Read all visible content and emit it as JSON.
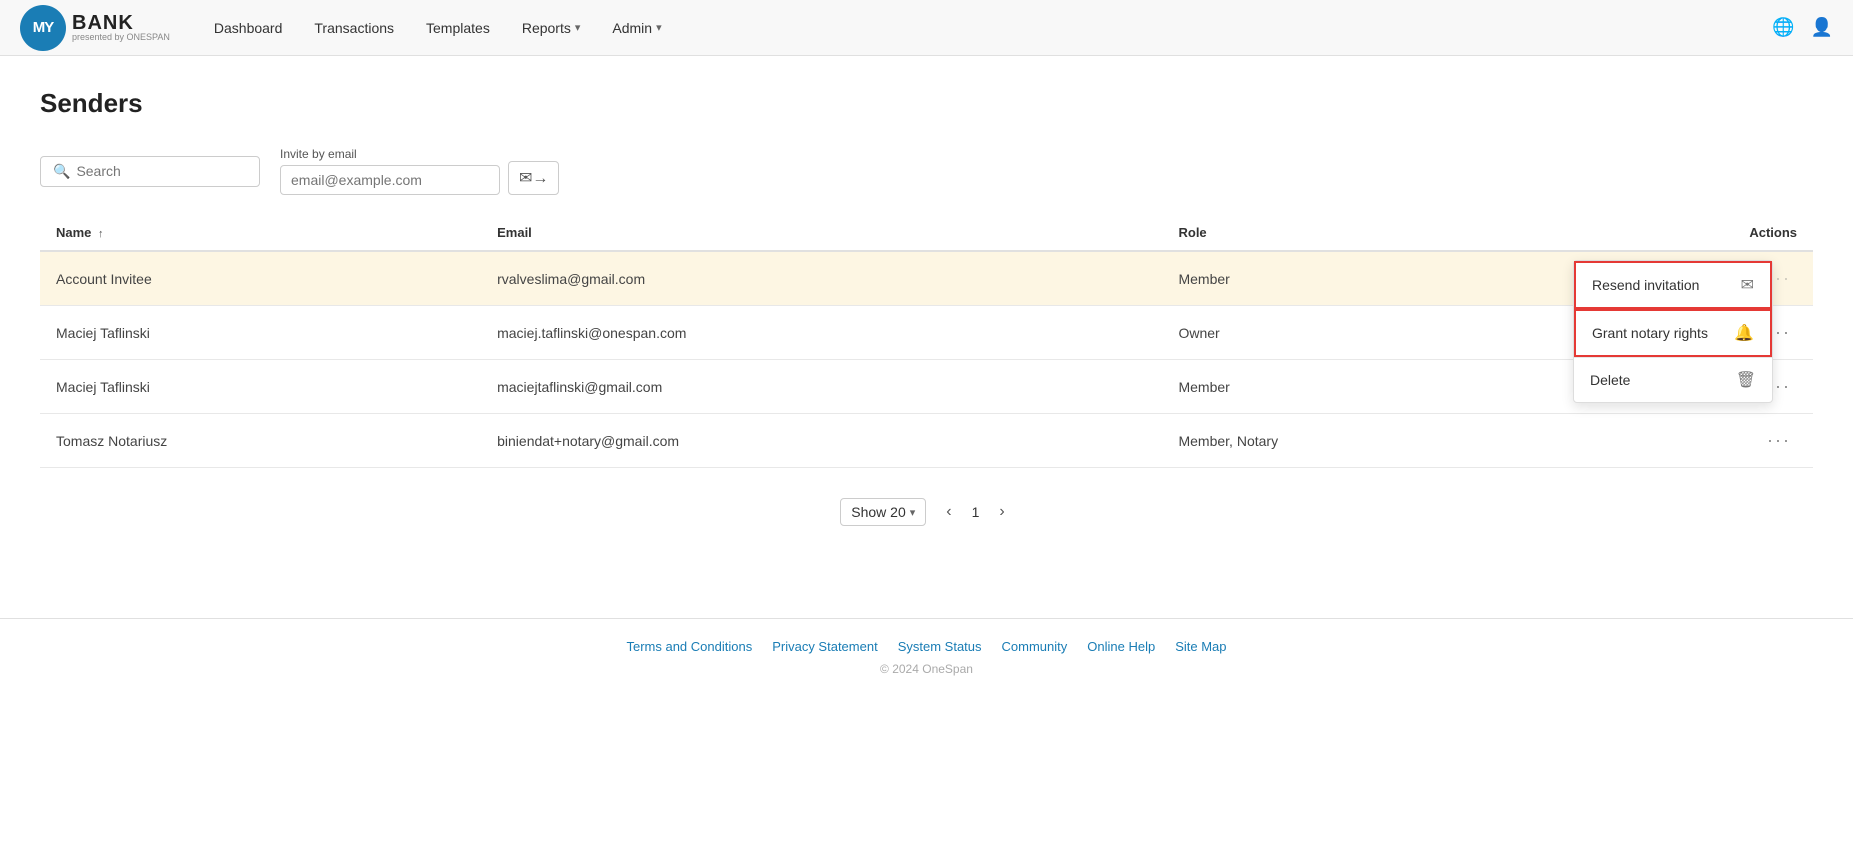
{
  "brand": {
    "logo_text": "MY BANK",
    "logo_my": "MY",
    "logo_bank": "BANK",
    "logo_sub": "presented by ONESPAN"
  },
  "nav": {
    "links": [
      {
        "id": "dashboard",
        "label": "Dashboard",
        "has_dropdown": false
      },
      {
        "id": "transactions",
        "label": "Transactions",
        "has_dropdown": false
      },
      {
        "id": "templates",
        "label": "Templates",
        "has_dropdown": false
      },
      {
        "id": "reports",
        "label": "Reports",
        "has_dropdown": true
      },
      {
        "id": "admin",
        "label": "Admin",
        "has_dropdown": true
      }
    ]
  },
  "page": {
    "title": "Senders"
  },
  "toolbar": {
    "search_placeholder": "Search",
    "invite_label": "Invite by email",
    "invite_placeholder": "email@example.com",
    "invite_btn_icon": "✉"
  },
  "table": {
    "columns": [
      {
        "id": "name",
        "label": "Name",
        "sortable": true
      },
      {
        "id": "email",
        "label": "Email",
        "sortable": false
      },
      {
        "id": "role",
        "label": "Role",
        "sortable": false
      },
      {
        "id": "actions",
        "label": "Actions",
        "sortable": false
      }
    ],
    "rows": [
      {
        "id": "row1",
        "name": "Account Invitee",
        "email": "rvalveslima@gmail.com",
        "role": "Member",
        "highlighted": true,
        "show_dropdown": true
      },
      {
        "id": "row2",
        "name": "Maciej Taflinski",
        "email": "maciej.taflinski@onespan.com",
        "role": "Owner",
        "highlighted": false,
        "show_dropdown": false
      },
      {
        "id": "row3",
        "name": "Maciej Taflinski",
        "email": "maciejtaflinski@gmail.com",
        "role": "Member",
        "highlighted": false,
        "show_dropdown": false
      },
      {
        "id": "row4",
        "name": "Tomasz Notariusz",
        "email": "biniendat+notary@gmail.com",
        "role": "Member, Notary",
        "highlighted": false,
        "show_dropdown": false
      }
    ]
  },
  "dropdown": {
    "items": [
      {
        "id": "resend",
        "label": "Resend invitation",
        "icon": "✉",
        "highlighted": true
      },
      {
        "id": "grant_notary",
        "label": "Grant notary rights",
        "icon": "🔔",
        "highlighted": true
      },
      {
        "id": "delete",
        "label": "Delete",
        "icon": "🗑"
      }
    ]
  },
  "pagination": {
    "show_label": "Show 20",
    "current_page": "1"
  },
  "footer": {
    "links": [
      {
        "id": "terms",
        "label": "Terms and Conditions"
      },
      {
        "id": "privacy",
        "label": "Privacy Statement"
      },
      {
        "id": "status",
        "label": "System Status"
      },
      {
        "id": "community",
        "label": "Community"
      },
      {
        "id": "help",
        "label": "Online Help"
      },
      {
        "id": "sitemap",
        "label": "Site Map"
      }
    ],
    "copyright": "© 2024 OneSpan"
  }
}
